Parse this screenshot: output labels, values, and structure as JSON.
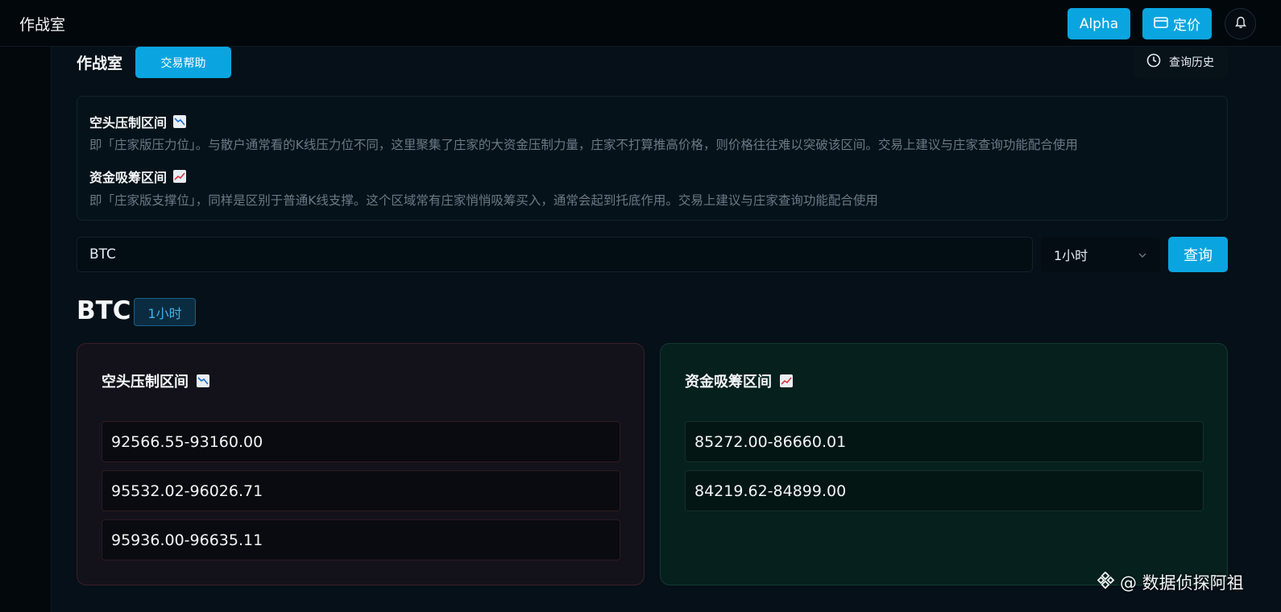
{
  "header": {
    "app_title": "作战室",
    "alpha_label": "Alpha",
    "pricing_label": "定价",
    "pricing_icon": "card-icon",
    "bell_icon": "bell-icon"
  },
  "section": {
    "title": "作战室",
    "help_label": "交易帮助",
    "history_label": "查询历史",
    "history_icon": "clock-icon"
  },
  "info": {
    "short_title": "空头压制区间",
    "short_desc": "即「庄家版压力位」。与散户通常看的K线压力位不同，这里聚集了庄家的大资金压制力量，庄家不打算推高价格，则价格往往难以突破该区间。交易上建议与庄家查询功能配合使用",
    "accum_title": "资金吸筹区间",
    "accum_desc": "即「庄家版支撑位」，同样是区别于普通K线支撑。这个区域常有庄家悄悄吸筹买入，通常会起到托底作用。交易上建议与庄家查询功能配合使用"
  },
  "search": {
    "value": "BTC",
    "timeframe": "1小时",
    "query_label": "查询"
  },
  "result": {
    "symbol": "BTC",
    "timeframe_badge": "1小时",
    "short_card": {
      "title": "空头压制区间",
      "ranges": [
        "92566.55-93160.00",
        "95532.02-96026.71",
        "95936.00-96635.11"
      ]
    },
    "accum_card": {
      "title": "资金吸筹区间",
      "ranges": [
        "85272.00-86660.01",
        "84219.62-84899.00"
      ]
    }
  },
  "watermark": "@ 数据侦探阿祖",
  "colors": {
    "accent": "#0aa5e0",
    "short_card_bg": "#13121a",
    "accum_card_bg": "#06201e"
  }
}
